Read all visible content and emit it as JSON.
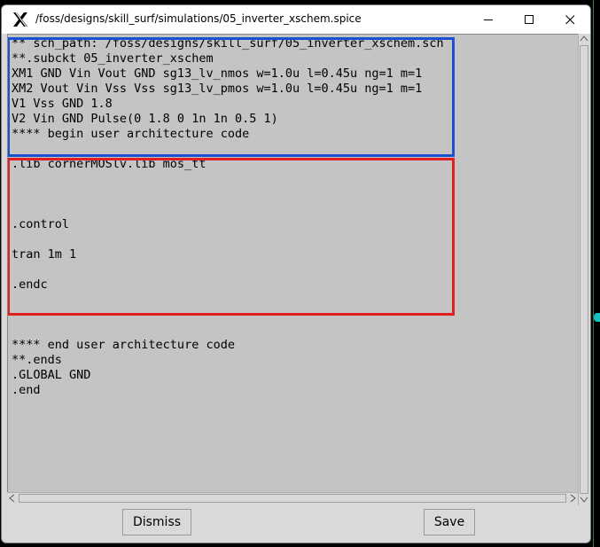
{
  "window": {
    "title": "/foss/designs/skill_surf/simulations/05_inverter_xschem.spice",
    "controls": {
      "minimize": "minimize-icon",
      "maximize": "maximize-icon",
      "close": "close-icon"
    }
  },
  "editor": {
    "lines": [
      "** sch_path: /foss/designs/skill_surf/05_inverter_xschem.sch",
      "**.subckt 05_inverter_xschem",
      "XM1 GND Vin Vout GND sg13_lv_nmos w=1.0u l=0.45u ng=1 m=1",
      "XM2 Vout Vin Vss Vss sg13_lv_pmos w=1.0u l=0.45u ng=1 m=1",
      "V1 Vss GND 1.8",
      "V2 Vin GND Pulse(0 1.8 0 1n 1n 0.5 1)",
      "**** begin user architecture code",
      "",
      ".lib cornerMOSlv.lib mos_tt",
      "",
      "",
      "",
      ".control",
      "",
      "tran 1m 1",
      "",
      ".endc",
      "",
      "",
      "",
      "**** end user architecture code",
      "**.ends",
      ".GLOBAL GND",
      ".end"
    ],
    "highlight_colors": {
      "netlist_box": "#1a4fd6",
      "user_code_box": "#e0201e"
    }
  },
  "buttons": {
    "dismiss": "Dismiss",
    "save": "Save"
  }
}
